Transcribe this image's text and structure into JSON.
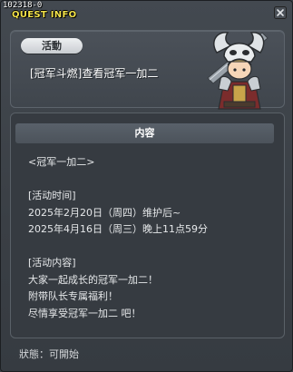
{
  "window": {
    "quest_id": "102318-0",
    "title": "QUEST INFO"
  },
  "quest": {
    "category": "活動",
    "name": "[冠军斗燃]查看冠军一加二"
  },
  "content": {
    "header": "内容",
    "lines": [
      "<冠军一加二>",
      "",
      "[活动时间]",
      "2025年2月20日（周四）维护后~",
      "2025年4月16日（周三）晚上11点59分",
      "",
      "[活动内容]",
      "大家一起成长的冠军一加二！",
      "附带队长专属福利！",
      "尽情享受冠军一加二 吧！"
    ]
  },
  "status": {
    "text": "狀態：可開始"
  },
  "icons": {
    "close": "close-icon",
    "npc": "npc-portrait-icon"
  }
}
